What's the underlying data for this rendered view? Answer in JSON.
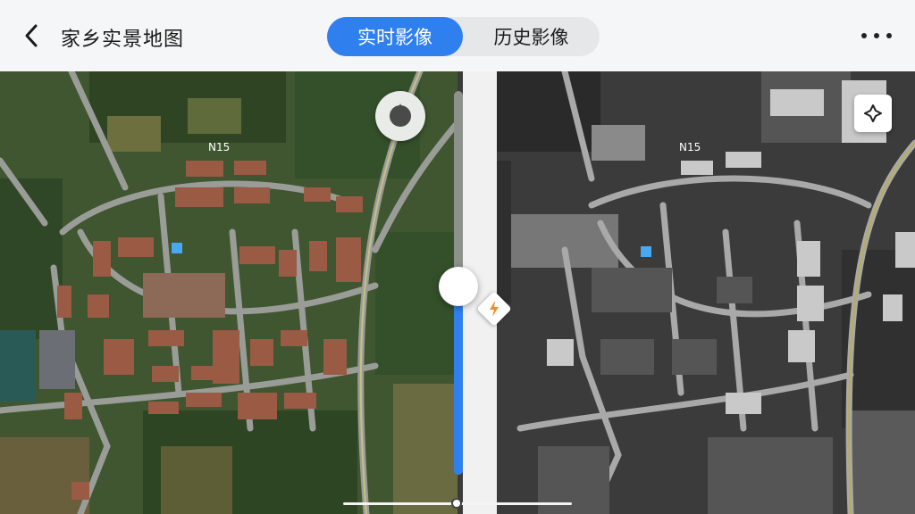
{
  "header": {
    "title": "家乡实景地图",
    "tabs": [
      {
        "label": "实时影像",
        "active": true
      },
      {
        "label": "历史影像",
        "active": false
      }
    ]
  },
  "map": {
    "road_label_left": "N15",
    "road_label_right": "N15",
    "accent_color": "#2f80ee"
  },
  "icons": {
    "back": "chevron-left-icon",
    "more": "more-horizontal-icon",
    "compass": "compass-icon",
    "locate": "locate-icon",
    "split": "compare-handle-icon"
  }
}
